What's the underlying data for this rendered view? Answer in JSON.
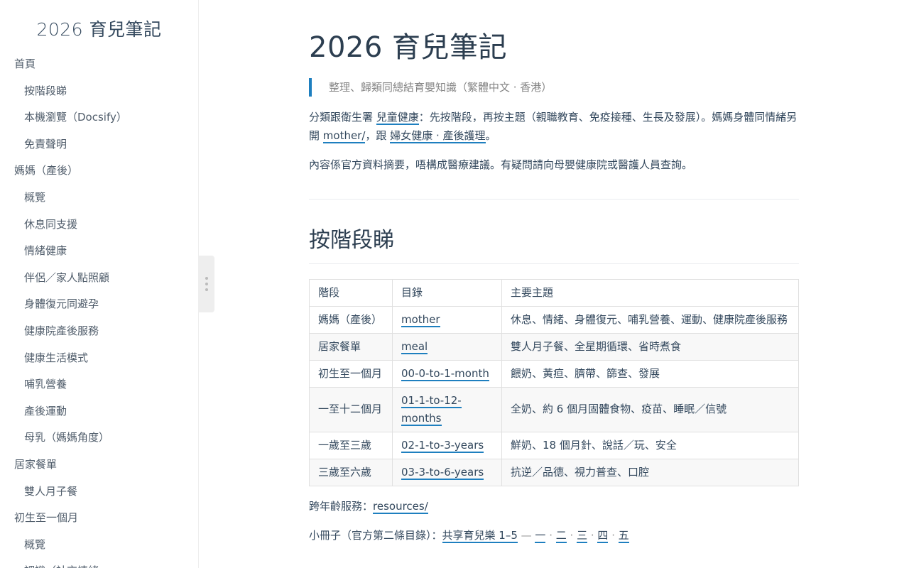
{
  "app": {
    "name": "2026 育兒筆記"
  },
  "sidebar": {
    "items": [
      {
        "label": "首頁",
        "level": 1
      },
      {
        "label": "按階段睇",
        "level": 2
      },
      {
        "label": "本機瀏覽（Docsify）",
        "level": 2
      },
      {
        "label": "免責聲明",
        "level": 2
      },
      {
        "label": "媽媽（產後）",
        "level": 1
      },
      {
        "label": "概覽",
        "level": 2
      },
      {
        "label": "休息同支援",
        "level": 2
      },
      {
        "label": "情緒健康",
        "level": 2
      },
      {
        "label": "伴侶／家人點照顧",
        "level": 2
      },
      {
        "label": "身體復元同避孕",
        "level": 2
      },
      {
        "label": "健康院產後服務",
        "level": 2
      },
      {
        "label": "健康生活模式",
        "level": 2
      },
      {
        "label": "哺乳營養",
        "level": 2
      },
      {
        "label": "產後運動",
        "level": 2
      },
      {
        "label": "母乳（媽媽角度）",
        "level": 2
      },
      {
        "label": "居家餐單",
        "level": 1
      },
      {
        "label": "雙人月子餐",
        "level": 2
      },
      {
        "label": "初生至一個月",
        "level": 1
      },
      {
        "label": "概覽",
        "level": 2
      },
      {
        "label": "認識（社交情緒",
        "level": 2
      }
    ]
  },
  "main": {
    "title": "2026 育兒筆記",
    "subtitle": "整理、歸類同總結育嬰知識（繁體中文 · 香港）",
    "intro": {
      "p1_a": "分類跟衛生署 ",
      "p1_link1": "兒童健康",
      "p1_b": "：先按階段，再按主題（親職教育、免疫接種、生長及發展）。媽媽身體同情緒另開 ",
      "p1_link2": "mother/",
      "p1_c": "，跟 ",
      "p1_link3": "婦女健康 · 產後護理",
      "p1_d": "。",
      "p2": "內容係官方資料摘要，唔構成醫療建議。有疑問請向母嬰健康院或醫護人員查詢。"
    },
    "section_title": "按階段睇",
    "table": {
      "headers": [
        "階段",
        "目錄",
        "主要主題"
      ],
      "rows": [
        {
          "stage": "媽媽（產後）",
          "dir": "mother",
          "topics": "休息、情緒、身體復元、哺乳營養、運動、健康院產後服務"
        },
        {
          "stage": "居家餐單",
          "dir": "meal",
          "topics": "雙人月子餐、全星期循環、省時煮食"
        },
        {
          "stage": "初生至一個月",
          "dir": "00-0-to-1-month",
          "topics": "餵奶、黃疸、臍帶、篩查、發展"
        },
        {
          "stage": "一至十二個月",
          "dir": "01-1-to-12-months",
          "topics": "全奶、約 6 個月固體食物、疫苗、睡眠／信號"
        },
        {
          "stage": "一歲至三歲",
          "dir": "02-1-to-3-years",
          "topics": "鮮奶、18 個月針、說話／玩、安全"
        },
        {
          "stage": "三歲至六歲",
          "dir": "03-3-to-6-years",
          "topics": "抗逆／品德、視力普查、口腔"
        }
      ]
    },
    "cross_age": {
      "label": "跨年齡服務：",
      "link": "resources/"
    },
    "booklets": {
      "label": "小冊子（官方第二條目錄）：",
      "main_link": "共享育兒樂 1–5",
      "dash": " — ",
      "links": [
        "一",
        "二",
        "三",
        "四",
        "五"
      ],
      "sep": " · "
    }
  },
  "colors": {
    "accent": "#1e7fbf",
    "text": "#34495e",
    "heading": "#2c3e50"
  }
}
